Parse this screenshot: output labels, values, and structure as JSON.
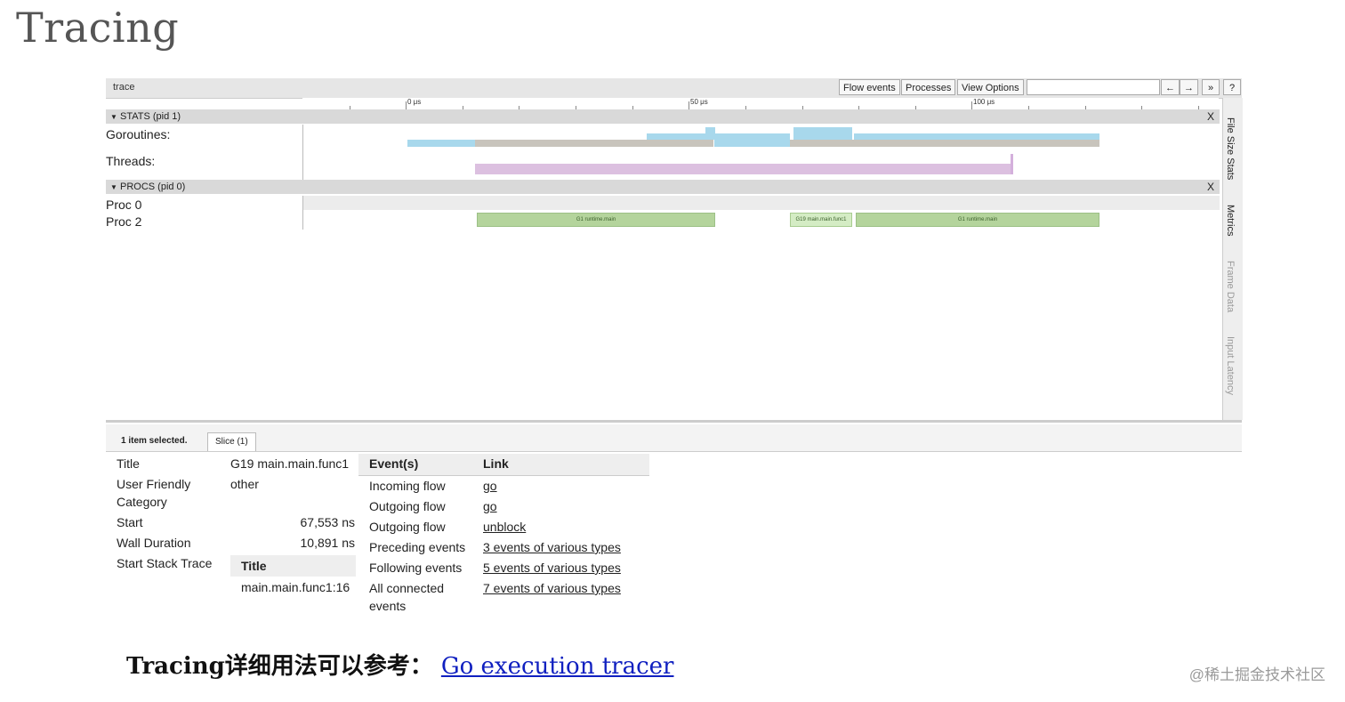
{
  "slide": {
    "title": "Tracing",
    "caption_prefix": "Tracing详细用法可以参考：",
    "caption_link": "Go execution tracer",
    "watermark": "@稀土掘金技术社区"
  },
  "toolbar": {
    "label": "trace",
    "buttons": [
      "Flow events",
      "Processes",
      "View Options"
    ],
    "nav_left": "←",
    "nav_right": "→",
    "nav_more": "»",
    "help": "?"
  },
  "ruler": {
    "labels": [
      "0 μs",
      "50 μs",
      "100 μs"
    ]
  },
  "groups": {
    "stats": {
      "label": "STATS (pid 1)",
      "close": "X",
      "rows": [
        "Goroutines:",
        "Threads:"
      ]
    },
    "procs": {
      "label": "PROCS (pid 0)",
      "close": "X",
      "rows": [
        "Proc 0",
        "Proc 2"
      ]
    }
  },
  "slices": [
    "G1 runtime.main",
    "G19 main.main.func1",
    "G1 runtime.main"
  ],
  "side_tabs": [
    "File Size Stats",
    "Metrics",
    "Frame Data",
    "Input Latency"
  ],
  "panel": {
    "selected_count": "1 item selected.",
    "tab": "Slice (1)",
    "details": [
      {
        "key": "Title",
        "value": "G19 main.main.func1"
      },
      {
        "key": "User Friendly Category",
        "value": "other"
      },
      {
        "key": "Start",
        "value": "67,553 ns"
      },
      {
        "key": "Wall Duration",
        "value": "10,891 ns"
      },
      {
        "key": "Start Stack Trace",
        "value": ""
      }
    ],
    "stack_table": {
      "header": "Title",
      "rows": [
        "main.main.func1:16"
      ]
    },
    "events_table": {
      "headers": [
        "Event(s)",
        "Link"
      ],
      "rows": [
        {
          "event": "Incoming flow",
          "link": "go"
        },
        {
          "event": "Outgoing flow",
          "link": "go"
        },
        {
          "event": "Outgoing flow",
          "link": "unblock"
        },
        {
          "event": "Preceding events",
          "link": "3 events of various types"
        },
        {
          "event": "Following events",
          "link": "5 events of various types"
        },
        {
          "event": "All connected events",
          "link": "7 events of various types"
        }
      ]
    }
  },
  "colors": {
    "goroutines_blue": "#a8d8ec",
    "goroutines_gray": "#c8c4bc",
    "threads_purple": "#dcc0e0",
    "slice_green": "#b4d49c",
    "slice_selected": "#d4ecc4",
    "caption_link": "#1020c0"
  }
}
